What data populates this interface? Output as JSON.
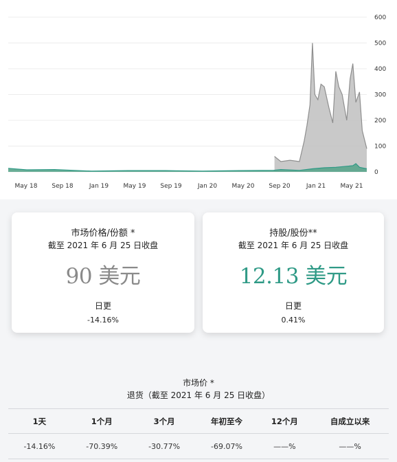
{
  "chart_data": {
    "type": "area",
    "x_ticks": [
      "May 18",
      "Sep 18",
      "Jan 19",
      "May 19",
      "Sep 19",
      "Jan 20",
      "May 20",
      "Sep 20",
      "Jan 21",
      "May 21"
    ],
    "ylim": [
      0,
      600
    ],
    "y_ticks": [
      "600",
      "500",
      "400",
      "300",
      "200",
      "100",
      "0"
    ],
    "grid": true,
    "series": [
      {
        "color": "#8e8e8e",
        "fill": "#c3c3c3",
        "x": [
          "2018-04",
          "2018-06",
          "2018-09",
          "2019-01",
          "2019-05",
          "2019-09",
          "2020-01",
          "2020-05",
          "2020-08-20",
          "2020-08-25",
          "2020-09-15",
          "2020-10-15",
          "2020-11-15",
          "2020-12-01",
          "2020-12-10",
          "2020-12-20",
          "2020-12-28",
          "2021-01-05",
          "2021-01-15",
          "2021-01-25",
          "2021-02-05",
          "2021-02-20",
          "2021-03-05",
          "2021-03-15",
          "2021-03-25",
          "2021-04-05",
          "2021-04-20",
          "2021-05-01",
          "2021-05-10",
          "2021-05-20",
          "2021-06-01",
          "2021-06-10",
          "2021-06-25"
        ],
        "values": [
          null,
          null,
          null,
          null,
          null,
          null,
          null,
          null,
          null,
          60,
          40,
          45,
          40,
          120,
          180,
          260,
          500,
          300,
          280,
          340,
          330,
          250,
          190,
          390,
          330,
          300,
          200,
          360,
          420,
          270,
          310,
          160,
          90
        ]
      },
      {
        "color": "#2f9a86",
        "fill": "#5aa58c",
        "x": [
          "2018-04",
          "2018-06",
          "2018-09",
          "2019-01",
          "2019-05",
          "2019-09",
          "2020-01",
          "2020-05",
          "2020-08-20",
          "2020-09-15",
          "2020-11-15",
          "2020-12-28",
          "2021-02-05",
          "2021-03-15",
          "2021-04-20",
          "2021-05-10",
          "2021-05-20",
          "2021-06-01",
          "2021-06-25"
        ],
        "values": [
          14,
          8,
          9,
          3,
          5,
          5,
          3,
          5,
          6,
          9,
          6,
          12,
          16,
          18,
          22,
          24,
          32,
          18,
          12
        ]
      }
    ]
  },
  "cards": {
    "price": {
      "title": "市场价格/份额 *",
      "subtitle": "截至 2021 年 6 月 25 日收盘",
      "value": "90 美元",
      "change_label": "日更",
      "change_value": "-14.16%"
    },
    "nav": {
      "title": "持股/股份**",
      "subtitle": "截至 2021 年 6 月 25 日收盘",
      "value": "12.13 美元",
      "change_label": "日更",
      "change_value": "0.41%"
    }
  },
  "returns": {
    "title": "市场价 *",
    "subtitle": "退货（截至 2021 年 6 月 25 日收盘）",
    "headers": [
      "1天",
      "1个月",
      "3个月",
      "年初至今",
      "12个月",
      "自成立以来"
    ],
    "values": [
      "-14.16%",
      "-70.39%",
      "-30.77%",
      "-69.07%",
      "——%",
      "——%"
    ]
  }
}
